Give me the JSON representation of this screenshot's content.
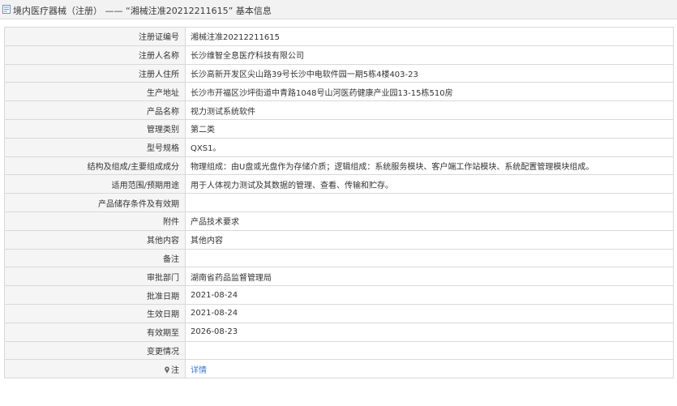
{
  "header": {
    "title": "境内医疗器械（注册） —— “湘械注准20212211615” 基本信息",
    "icon": "document-icon"
  },
  "rows": [
    {
      "label": "注册证编号",
      "value": "湘械注准20212211615"
    },
    {
      "label": "注册人名称",
      "value": "长沙维智全息医疗科技有限公司"
    },
    {
      "label": "注册人住所",
      "value": "长沙高新开发区尖山路39号长沙中电软件园一期5栋4楼403-23"
    },
    {
      "label": "生产地址",
      "value": "长沙市开福区沙坪街道中青路1048号山河医药健康产业园13-15栋510房"
    },
    {
      "label": "产品名称",
      "value": "视力测试系统软件"
    },
    {
      "label": "管理类别",
      "value": "第二类"
    },
    {
      "label": "型号规格",
      "value": "QXS1。"
    },
    {
      "label": "结构及组成/主要组成成分",
      "value": "物理组成：由U盘或光盘作为存储介质；逻辑组成：系统服务模块、客户端工作站模块、系统配置管理模块组成。"
    },
    {
      "label": "适用范围/预期用途",
      "value": "用于人体视力测试及其数据的管理、查看、传输和贮存。"
    },
    {
      "label": "产品储存条件及有效期",
      "value": ""
    },
    {
      "label": "附件",
      "value": "产品技术要求"
    },
    {
      "label": "其他内容",
      "value": "其他内容"
    },
    {
      "label": "备注",
      "value": ""
    },
    {
      "label": "审批部门",
      "value": "湖南省药品监督管理局"
    },
    {
      "label": "批准日期",
      "value": "2021-08-24"
    },
    {
      "label": "生效日期",
      "value": "2021-08-24"
    },
    {
      "label": "有效期至",
      "value": "2026-08-23"
    },
    {
      "label": "变更情况",
      "value": ""
    }
  ],
  "note_row": {
    "label": "注",
    "icon": "location-pin-icon",
    "link_text": "详情"
  },
  "colors": {
    "label_bg": "#f5f5f5",
    "border": "#d9d9d9",
    "link": "#3a7bd5",
    "header_bg": "#f2f2f2"
  }
}
